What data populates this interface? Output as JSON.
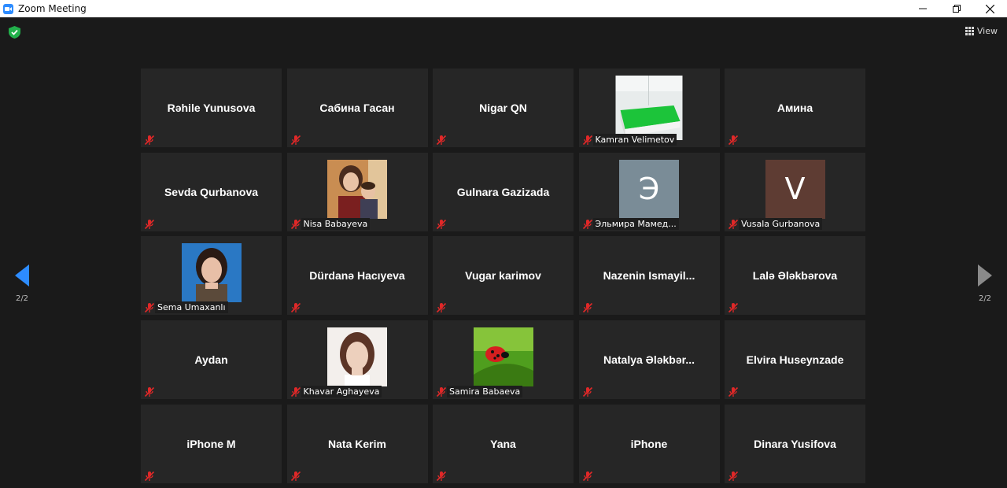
{
  "window": {
    "title": "Zoom Meeting"
  },
  "toolbar": {
    "view_label": "View"
  },
  "nav": {
    "left_page": "2/2",
    "right_page": "2/2"
  },
  "colors": {
    "accent": "#2d8cff",
    "mute_red": "#e02828",
    "security_green": "#22b04b"
  },
  "participants": [
    {
      "name": "Rəhile Yunusova",
      "video": false
    },
    {
      "name": "Сабина Гасан",
      "video": false
    },
    {
      "name": "Nigar QN",
      "video": false
    },
    {
      "name": "Kamran Velimetov",
      "video": true,
      "thumb": "green-table"
    },
    {
      "name": "Амина",
      "video": false
    },
    {
      "name": "Sevda Qurbanova",
      "video": false
    },
    {
      "name": "Nisa Babayeva",
      "video": true,
      "thumb": "mother-child"
    },
    {
      "name": "Gulnara Gazizada",
      "video": false
    },
    {
      "name": "Эльмира Мамед...",
      "video": true,
      "thumb": "letter",
      "letter": "Э",
      "letter_bg": "#7a8c97"
    },
    {
      "name": "Vusala Gurbanova",
      "video": true,
      "thumb": "letter",
      "letter": "V",
      "letter_bg": "#5e3c33"
    },
    {
      "name": "Sema Umaxanlı",
      "video": true,
      "thumb": "portrait-blue"
    },
    {
      "name": "Dürdanə Hacıyeva",
      "video": false
    },
    {
      "name": "Vugar karimov",
      "video": false
    },
    {
      "name": "Nazenin  Ismayil...",
      "video": false
    },
    {
      "name": "Lalə Ələkbərova",
      "video": false
    },
    {
      "name": "Aydan",
      "video": false
    },
    {
      "name": "Khavar Aghayeva",
      "video": true,
      "thumb": "portrait-white"
    },
    {
      "name": "Samira Babaeva",
      "video": true,
      "thumb": "ladybug"
    },
    {
      "name": "Natalya  Ələkbər...",
      "video": false
    },
    {
      "name": "Elvira Huseynzade",
      "video": false
    },
    {
      "name": "iPhone M",
      "video": false
    },
    {
      "name": "Nata Kerim",
      "video": false
    },
    {
      "name": "Yana",
      "video": false
    },
    {
      "name": "iPhone",
      "video": false
    },
    {
      "name": "Dinara Yusifova",
      "video": false
    }
  ]
}
